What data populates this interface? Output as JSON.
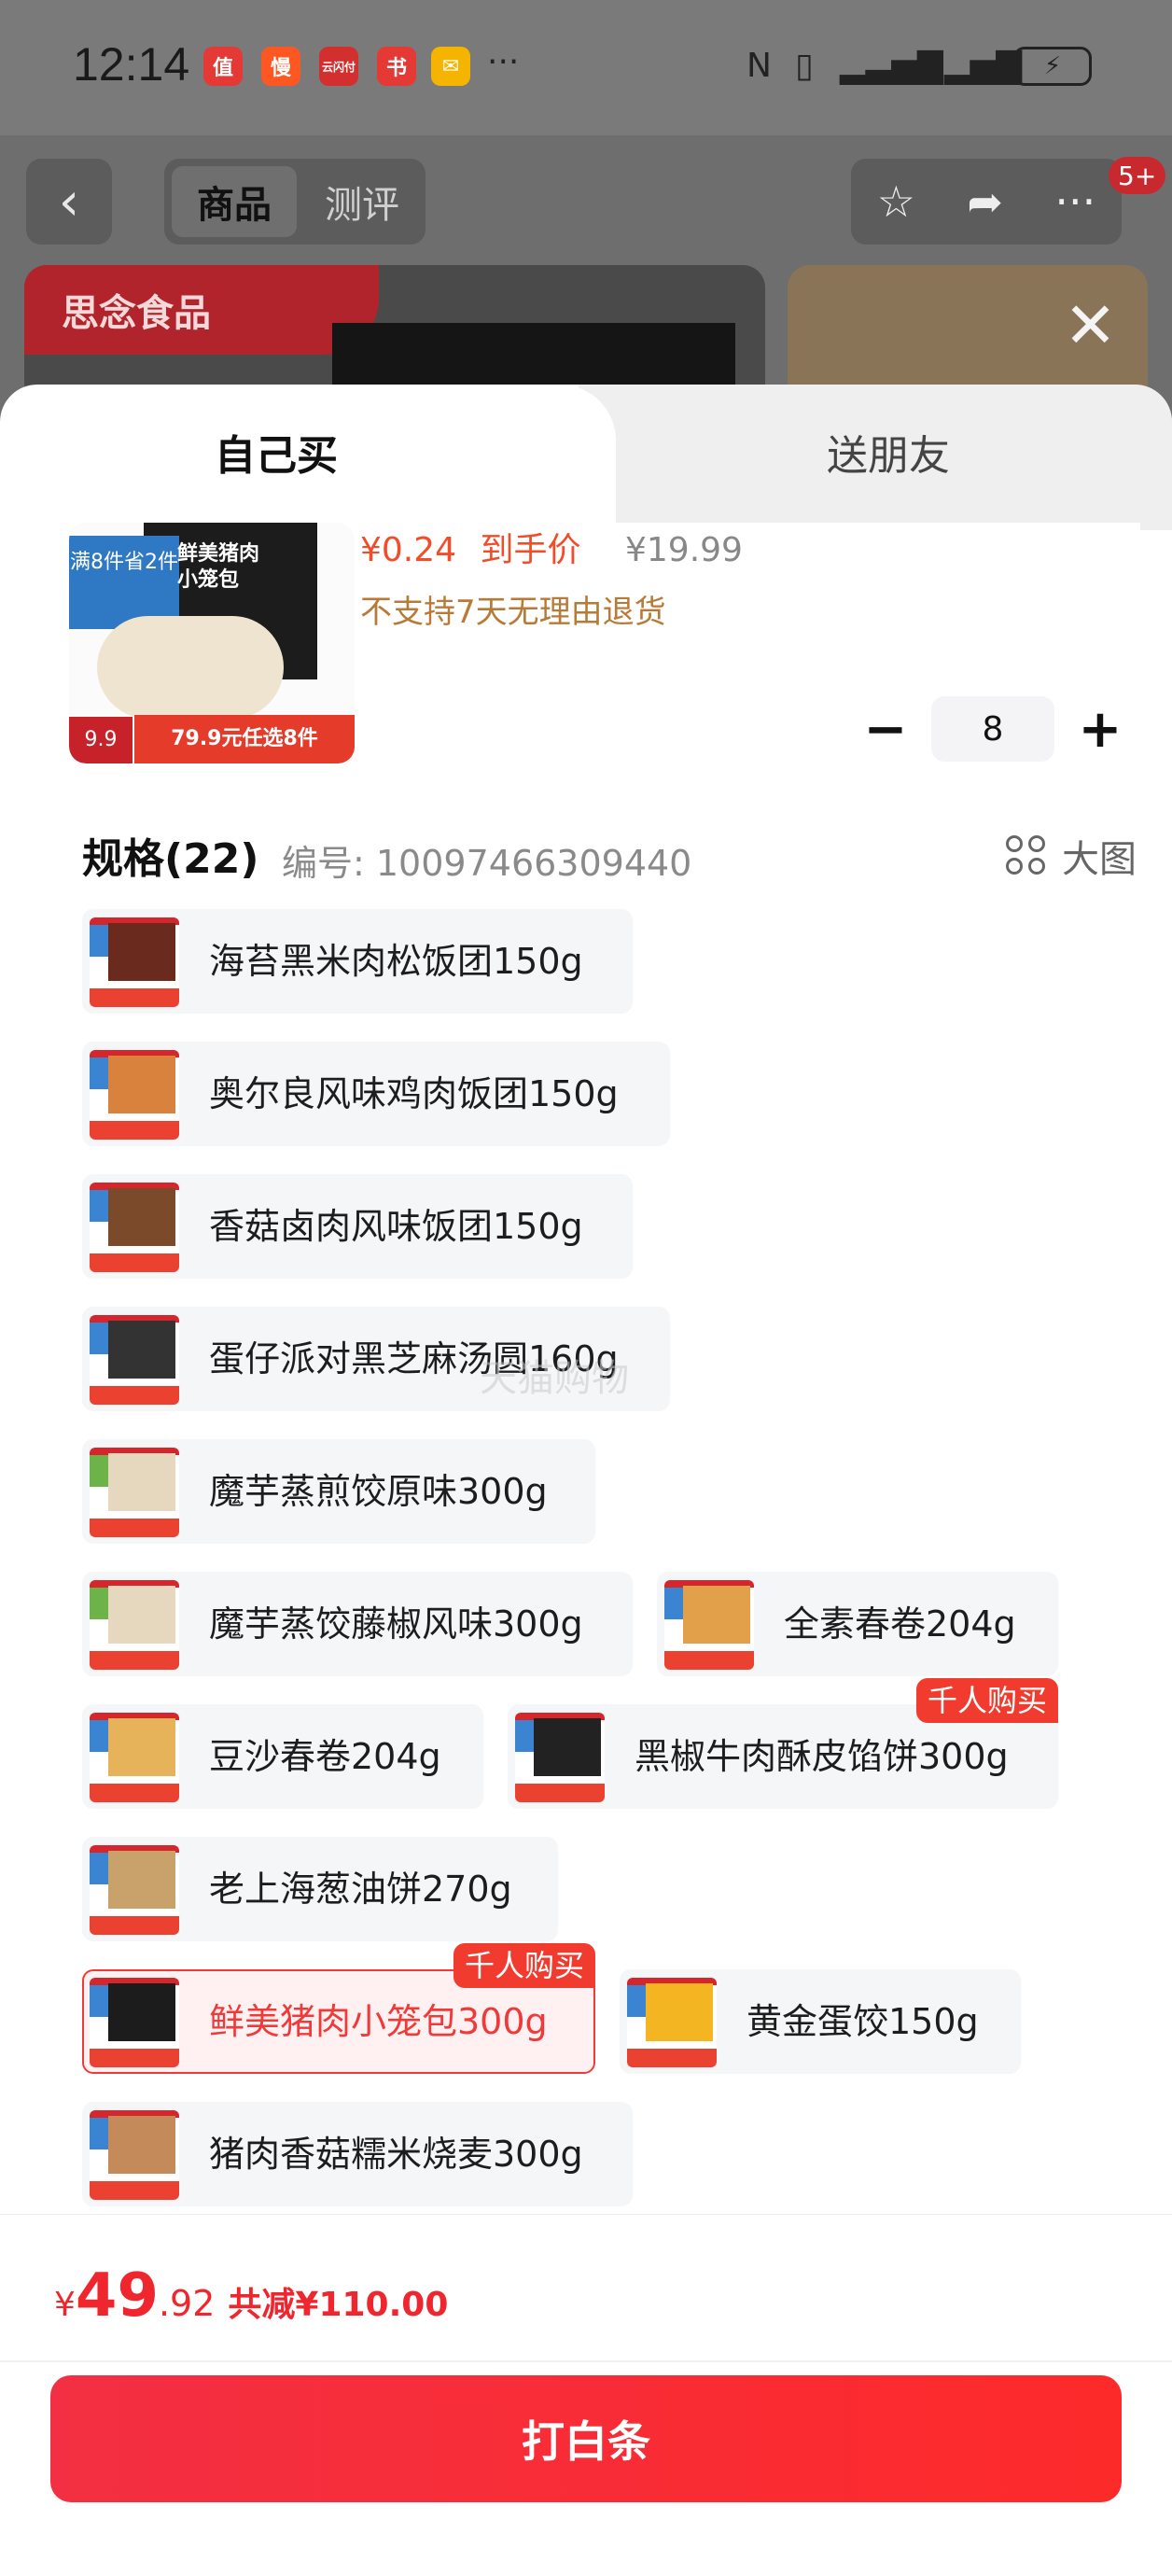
{
  "status": {
    "time": "12:14",
    "apps": [
      {
        "name": "值",
        "color": "#e53935"
      },
      {
        "name": "慢",
        "color": "#ff5722"
      },
      {
        "name": "云闪付",
        "color": "#d32f2f"
      },
      {
        "name": "书",
        "color": "#e53935"
      },
      {
        "name": "✉",
        "color": "#f4b400"
      }
    ],
    "more": "···"
  },
  "header": {
    "tab_product": "商品",
    "tab_review": "测评",
    "badge": "5+",
    "brand": "思念食品"
  },
  "sheet": {
    "tab_self": "自己买",
    "tab_gift": "送朋友"
  },
  "product": {
    "price": "¥0.24",
    "price_label": "到手价",
    "orig_price": "¥19.99",
    "return_policy": "不支持7天无理由退货",
    "img_title": "鲜美猪肉小笼包",
    "img_promo_left": "满8件省2件",
    "img_tag_price": "9.9",
    "img_tag_offer": "79.9元任选8件",
    "quantity": "8",
    "minus": "−",
    "plus": "+"
  },
  "spec": {
    "title": "规格(22)",
    "code": "编号: 10097466309440",
    "big_view": "大图",
    "items": [
      {
        "label": "海苔黑米肉松饭团150g",
        "hot": "",
        "selected": false
      },
      {
        "label": "奥尔良风味鸡肉饭团150g",
        "hot": "",
        "selected": false
      },
      {
        "label": "香菇卤肉风味饭团150g",
        "hot": "",
        "selected": false
      },
      {
        "label": "蛋仔派对黑芝麻汤圆160g",
        "hot": "",
        "selected": false
      },
      {
        "label": "魔芋蒸煎饺原味300g",
        "hot": "",
        "selected": false
      },
      {
        "label": "魔芋蒸饺藤椒风味300g",
        "hot": "",
        "selected": false
      },
      {
        "label": "全素春卷204g",
        "hot": "",
        "selected": false
      },
      {
        "label": "豆沙春卷204g",
        "hot": "",
        "selected": false
      },
      {
        "label": "黑椒牛肉酥皮馅饼300g",
        "hot": "千人购买",
        "selected": false
      },
      {
        "label": "老上海葱油饼270g",
        "hot": "",
        "selected": false
      },
      {
        "label": "鲜美猪肉小笼包300g",
        "hot": "千人购买",
        "selected": true
      },
      {
        "label": "黄金蛋饺150g",
        "hot": "",
        "selected": false
      },
      {
        "label": "猪肉香菇糯米烧麦300g",
        "hot": "",
        "selected": false
      }
    ],
    "watermark": "天猫购物"
  },
  "footer": {
    "currency": "¥",
    "total_int": "49",
    "total_dec": ".92",
    "discount": "共减¥110.00",
    "button": "打白条"
  },
  "colors": {
    "accent": "#f03a3a",
    "price": "#f44b28",
    "policy": "#b87a36"
  }
}
